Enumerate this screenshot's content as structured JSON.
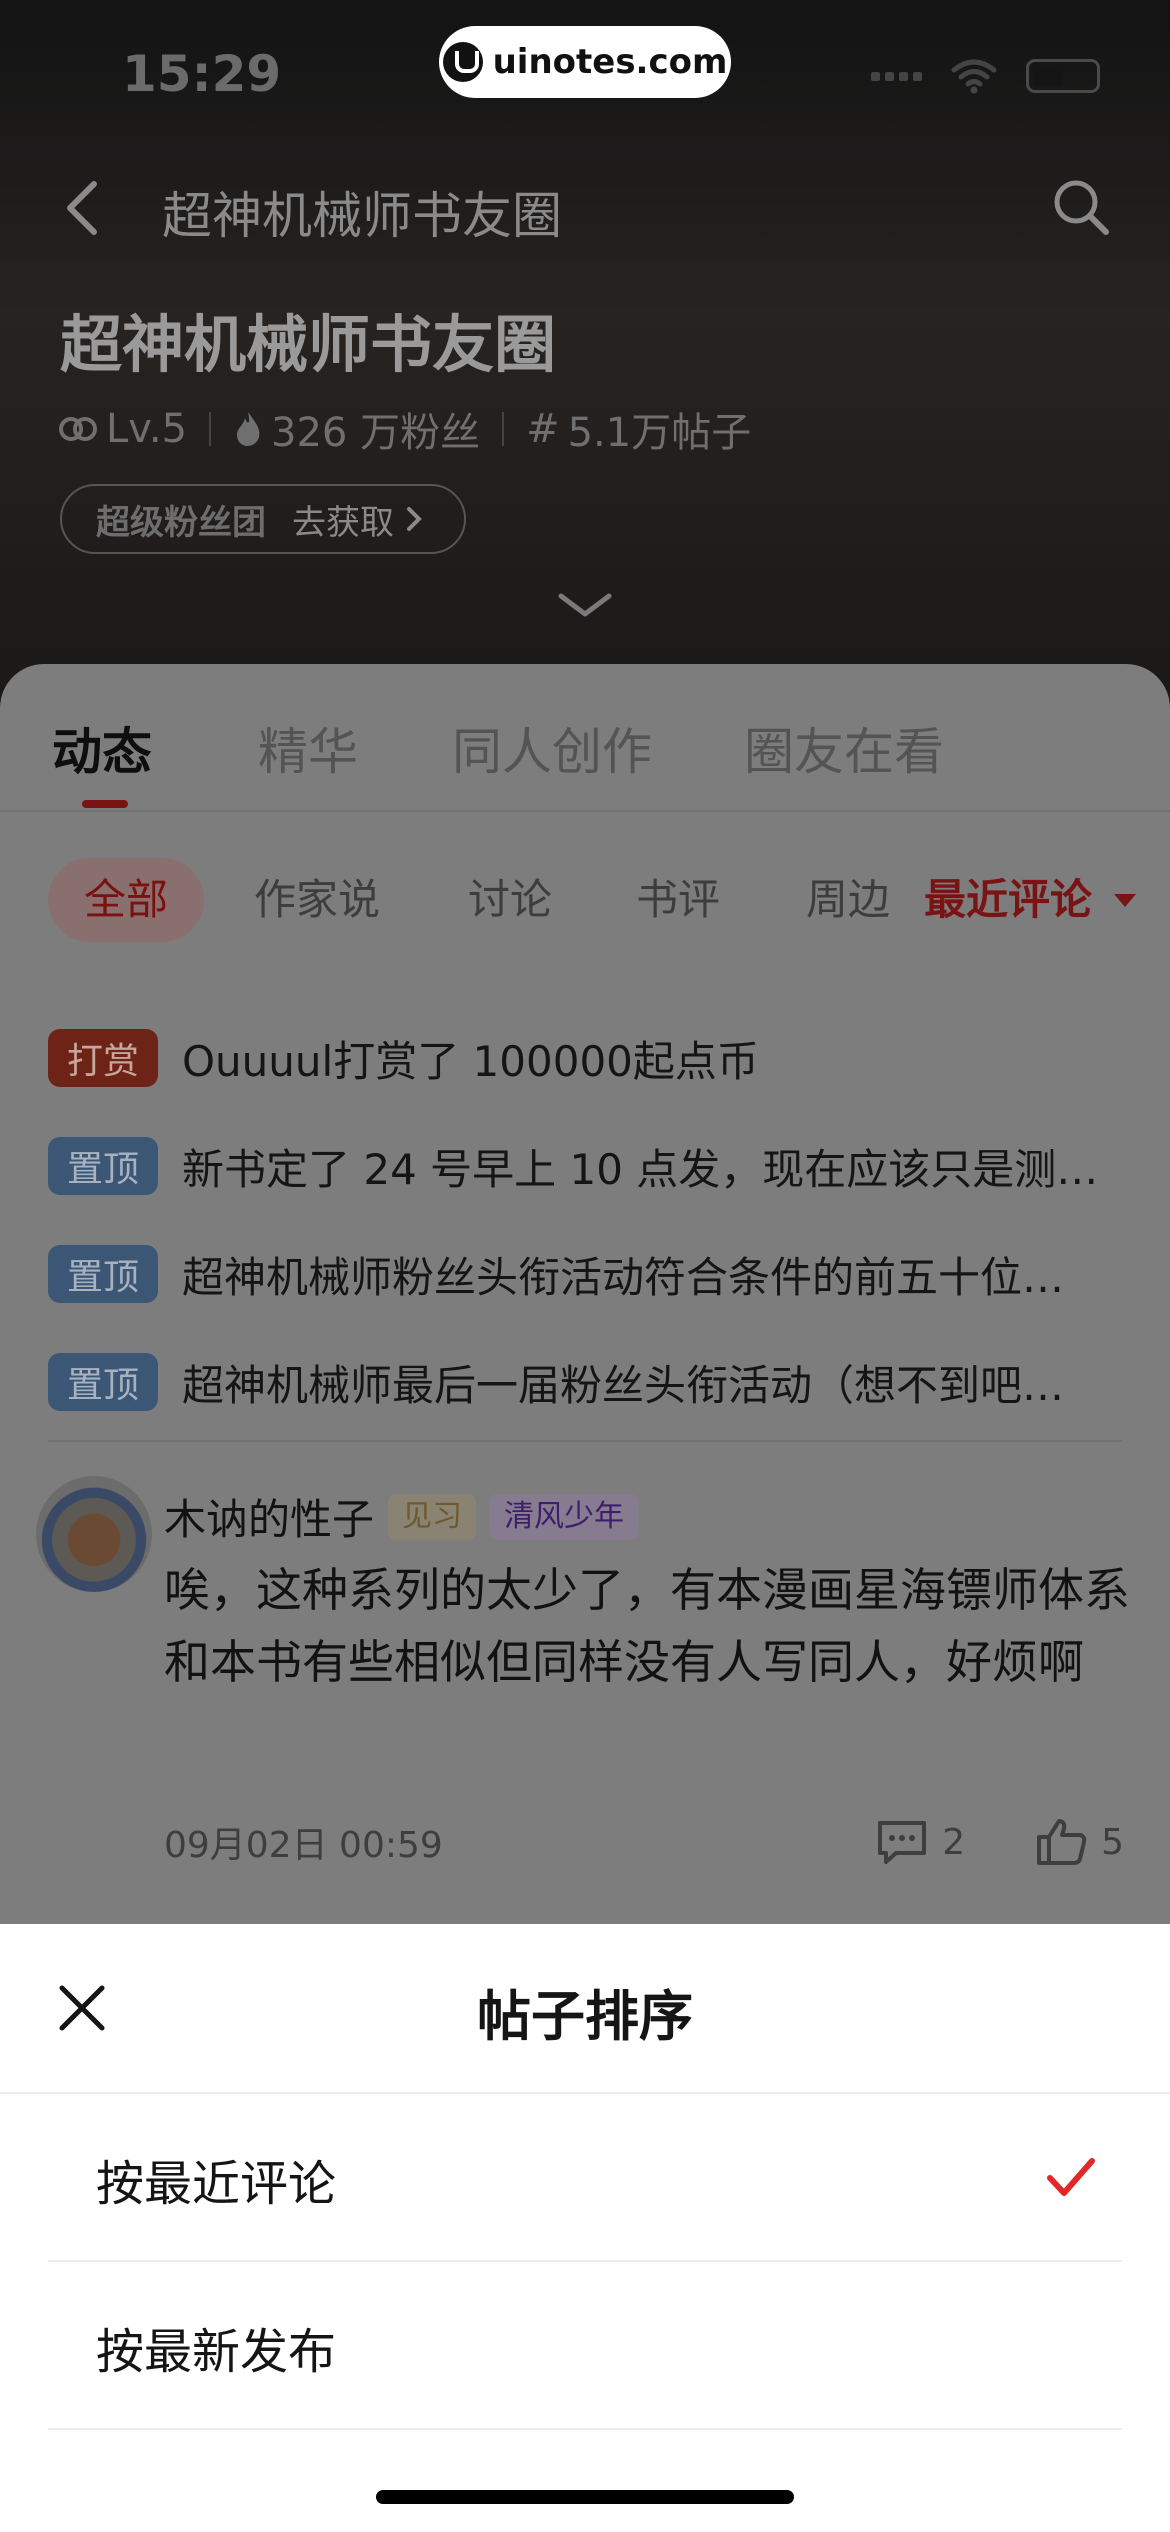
{
  "status_bar": {
    "time": "15:29"
  },
  "watermark": {
    "text": "uinotes.com"
  },
  "nav": {
    "title": "超神机械师书友圈"
  },
  "circle": {
    "title": "超神机械师书友圈",
    "level": "Lv.5",
    "fans": "326 万粉丝",
    "posts": "5.1万帖子",
    "fan_club_label": "超级粉丝团",
    "fan_club_action": "去获取"
  },
  "tabs": [
    {
      "label": "动态",
      "active": true
    },
    {
      "label": "精华"
    },
    {
      "label": "同人创作"
    },
    {
      "label": "圈友在看"
    }
  ],
  "filters": {
    "chips": [
      "全部",
      "作家说",
      "讨论",
      "书评",
      "周边"
    ],
    "active": "全部",
    "sort_label": "最近评论"
  },
  "pinned": [
    {
      "badge": "打赏",
      "type": "reward",
      "text": "Ouuuul打赏了 100000起点币"
    },
    {
      "badge": "置顶",
      "type": "pin",
      "text": "新书定了 24 号早上 10 点发，现在应该只是测试…"
    },
    {
      "badge": "置顶",
      "type": "pin",
      "text": "超神机械师粉丝头衔活动符合条件的前五十位…"
    },
    {
      "badge": "置顶",
      "type": "pin",
      "text": "超神机械师最后一届粉丝头衔活动（想不到吧…"
    }
  ],
  "post": {
    "author": "木讷的性子",
    "level_tag": "见习",
    "title_tag": "清风少年",
    "body": "唉，这种系列的太少了，有本漫画星海镖师体系和本书有些相似但同样没有人写同人，好烦啊",
    "time": "09月02日 00:59",
    "comments": "2",
    "likes": "5"
  },
  "sort_sheet": {
    "title": "帖子排序",
    "options": [
      {
        "label": "按最近评论",
        "selected": true
      },
      {
        "label": "按最新发布",
        "selected": false
      }
    ]
  },
  "colors": {
    "accent": "#E02828",
    "sheet_bg": "#FFFFFF",
    "overlay": "rgba(0,0,0,0.5)"
  }
}
